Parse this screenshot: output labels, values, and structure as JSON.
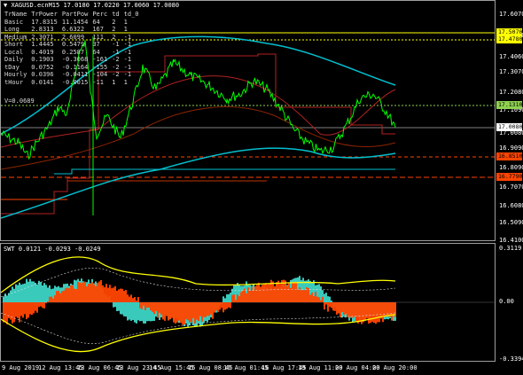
{
  "title": "XAGUSD.ecnM15  17.0180 17.0220 17.0060 17.0080",
  "title_arrow": "▼",
  "stats_headers": [
    "TrName",
    "TrPower",
    "PartPow",
    "Perc",
    "td",
    "td_0"
  ],
  "stats_rows": [
    [
      "Basic",
      "17.8315",
      "11.1454",
      "64",
      "2",
      "1"
    ],
    [
      "Long",
      "2.8313",
      "6.6322",
      "167",
      "2",
      "1"
    ],
    [
      "Medium",
      "2.3071",
      "2.6099",
      "111",
      "2",
      "-1"
    ],
    [
      "Short",
      "1.4445",
      "0.5479",
      "37",
      "-1",
      "-1"
    ],
    [
      "Local",
      "0.4019",
      "0.2587",
      "64",
      "-1",
      "-1"
    ],
    [
      "Daily",
      "0.1903",
      "-0.3068",
      "-161",
      "-2",
      "-1"
    ],
    [
      "tDay",
      "0.0752",
      "-0.1164",
      "-155",
      "-2",
      "-1"
    ],
    [
      "Hourly",
      "0.0396",
      "-0.0411",
      "-104",
      "-2",
      "-1"
    ],
    [
      "tHour",
      "0.0141",
      "-0.0015",
      "-11",
      "1",
      "1"
    ]
  ],
  "volatility_label": "V=0.0689",
  "price_axis_ticks": [
    "17.6070",
    "17.5070",
    "17.4060",
    "17.3070",
    "17.2080",
    "17.1090",
    "17.0080",
    "16.9090",
    "16.8090",
    "16.7070",
    "16.6080",
    "16.5090",
    "16.4100"
  ],
  "price_tags": [
    {
      "label": "17.5070",
      "color": "#ffff00"
    },
    {
      "label": "17.4780",
      "color": "#ffff00"
    },
    {
      "label": "17.1310",
      "color": "#8fd14f"
    },
    {
      "label": "17.0080",
      "color": "#ffffff"
    },
    {
      "label": "16.8510",
      "color": "#ff4500"
    },
    {
      "label": "16.7790",
      "color": "#ff4500"
    }
  ],
  "indicator_label": "SWT 0.0121 -0.0293 -0.0249",
  "indicator_ticks": [
    "0.3119",
    "0.00",
    "-0.3394"
  ],
  "x_axis_labels": [
    "9 Aug 2019",
    "12 Aug 13:45",
    "13 Aug 06:45",
    "13 Aug 23:45",
    "14 Aug 15:45",
    "15 Aug 08:45",
    "16 Aug 01:45",
    "16 Aug 17:45",
    "19 Aug 11:00",
    "20 Aug 04:00",
    "20 Aug 20:00"
  ],
  "colors": {
    "price": "#00ff00",
    "ma_cyan": "#00c0d0",
    "ma_red": "#b22222",
    "level_yellow": "#ffff00",
    "level_green": "#8fd14f",
    "level_red": "#ff4500",
    "hist_cyan": "#40e0d0",
    "hist_orange": "#ff4500",
    "hist_yellow": "#ffff00"
  }
}
